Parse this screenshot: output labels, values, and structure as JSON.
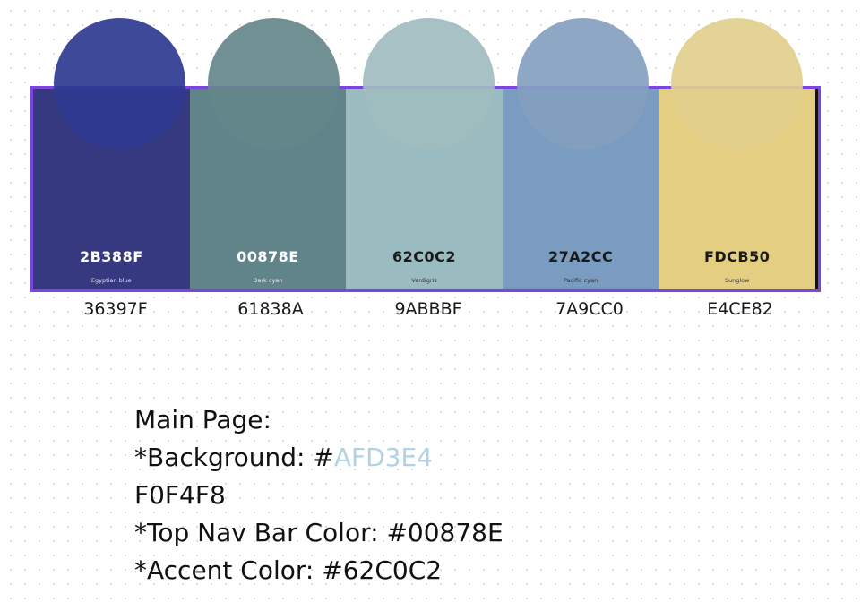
{
  "palette": {
    "swatches": [
      {
        "hex": "2B388F",
        "name": "Egyptian blue",
        "fill": "#36397f",
        "text_color": "#ffffff",
        "below_label": "36397F"
      },
      {
        "hex": "00878E",
        "name": "Dark cyan",
        "fill": "#61838a",
        "text_color": "#ffffff",
        "below_label": "61838A"
      },
      {
        "hex": "62C0C2",
        "name": "Verdigris",
        "fill": "#9abbbf",
        "text_color": "#1a1a1a",
        "below_label": "9ABBBF"
      },
      {
        "hex": "27A2CC",
        "name": "Pacific cyan",
        "fill": "#7a9cc0",
        "text_color": "#1a1a1a",
        "below_label": "7A9CC0"
      },
      {
        "hex": "FDCB50",
        "name": "Sunglow",
        "fill": "#e4ce82",
        "text_color": "#1a1a1a",
        "below_label": "E4CE82"
      }
    ],
    "circles": [
      "#2f3991",
      "#64878a",
      "#9fbcbf",
      "#83a0c0",
      "#e2cf8d"
    ]
  },
  "notes": {
    "line1": "Main Page:",
    "background_prefix": "*Background: #",
    "background_value": "AFD3E4",
    "line3": "F0F4F8",
    "line4": "*Top Nav Bar Color: #00878E",
    "line5": "*Accent Color: #62C0C2"
  }
}
